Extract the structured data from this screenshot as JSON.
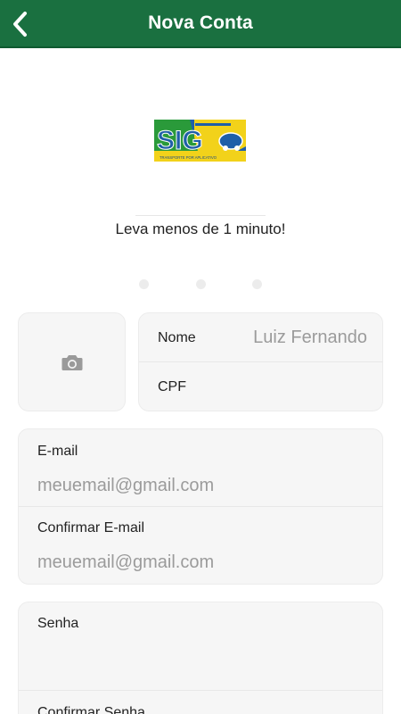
{
  "header": {
    "title": "Nova Conta",
    "back_icon": "chevron-left-icon"
  },
  "logo": {
    "text": "SIGO",
    "subtitle": "TRANSPORTE POR APLICATIVO"
  },
  "intro": {
    "tagline": "Leva menos de 1 minuto!"
  },
  "progress": {
    "steps": 3
  },
  "photo": {
    "icon": "camera-icon"
  },
  "personal": {
    "name_label": "Nome",
    "name_value": "Luiz Fernando",
    "cpf_label": "CPF",
    "cpf_value": ""
  },
  "email": {
    "email_label": "E-mail",
    "email_placeholder": "meuemail@gmail.com",
    "confirm_label": "Confirmar E-mail",
    "confirm_placeholder": "meuemail@gmail.com"
  },
  "password": {
    "password_label": "Senha",
    "password_value": "",
    "confirm_label": "Confirmar Senha"
  },
  "colors": {
    "header_bg": "#1a7040",
    "card_bg": "#f6f6f6",
    "placeholder_text": "#9b9b9b"
  }
}
